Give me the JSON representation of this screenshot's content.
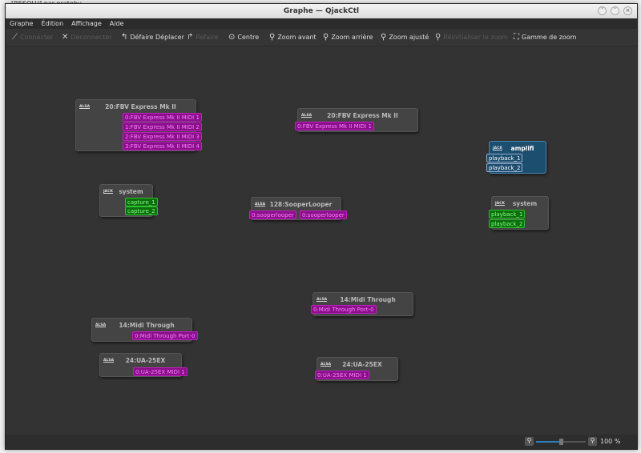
{
  "window": {
    "title": "Graphe — QjackCtl",
    "bg_text": "[RESOLU] par pratebu"
  },
  "menu": [
    "Graphe",
    "Édition",
    "Affichage",
    "Aide"
  ],
  "toolbar": {
    "connect": "Connecter",
    "disconnect": "Déconnecter",
    "undo": "Défaire Déplacer",
    "redo": "Refaire",
    "center": "Centre",
    "zoom_in": "Zoom avant",
    "zoom_out": "Zoom arrière",
    "zoom_fit": "Zoom ajusté",
    "zoom_reset": "Réinitialiser le zoom",
    "zoom_range": "Gamme de zoom"
  },
  "nodes": [
    {
      "title": "20:FBV Express Mk II",
      "type": "ALSA",
      "ports": [
        "0:FBV Express Mk II MIDI 1",
        "1:FBV Express Mk II MIDI 2",
        "2:FBV Express Mk II MIDI 3",
        "3:FBV Express Mk II MIDI 4"
      ]
    },
    {
      "title": "system",
      "type": "JACK",
      "ports": [
        "capture_1",
        "capture_2"
      ]
    },
    {
      "title": "20:FBV Express Mk II",
      "type": "ALSA",
      "ports": [
        "0:FBV Express Mk II MIDI 1"
      ]
    },
    {
      "title": "amplifi",
      "type": "JACK",
      "ports": [
        "playback_1",
        "playback_2"
      ]
    },
    {
      "title": "128:SooperLooper",
      "type": "ALSA",
      "ports": [
        "0:sooperlooper",
        "0:sooperlooper"
      ]
    },
    {
      "title": "system",
      "type": "JACK",
      "ports": [
        "playback_1",
        "playback_2"
      ]
    },
    {
      "title": "14:Midi Through",
      "type": "ALSA",
      "ports": [
        "0:Midi Through Port-0"
      ]
    },
    {
      "title": "14:Midi Through",
      "type": "ALSA",
      "ports": [
        "0:Midi Through Port-0"
      ]
    },
    {
      "title": "24:UA-25EX",
      "type": "ALSA",
      "ports": [
        "0:UA-25EX MIDI 1"
      ]
    },
    {
      "title": "24:UA-25EX",
      "type": "ALSA",
      "ports": [
        "0:UA-25EX MIDI 1"
      ]
    }
  ],
  "status": {
    "zoom_level": "100 %",
    "zoom_slider_percent": 50
  },
  "colors": {
    "midi_port": "#8a0f8a",
    "audio_port": "#0c6e0c",
    "selected_node": "#1c4e6f",
    "canvas": "#333333"
  }
}
